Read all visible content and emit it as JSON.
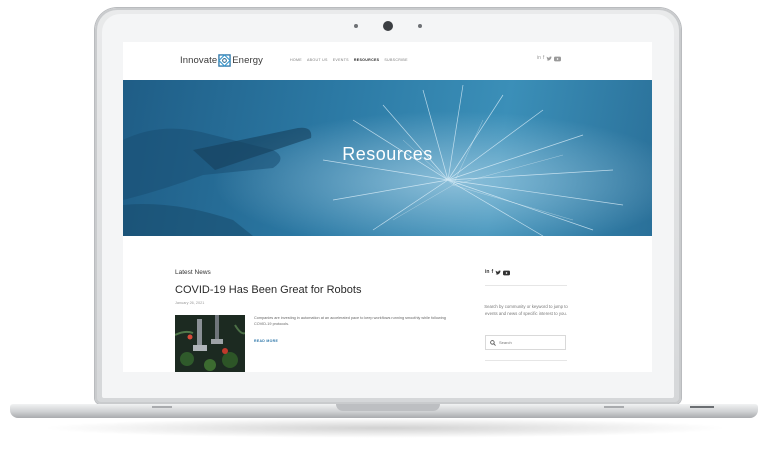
{
  "site": {
    "logo": {
      "left_text": "Innovate",
      "right_text": "Energy"
    },
    "nav": [
      {
        "label": "HOME",
        "active": false
      },
      {
        "label": "ABOUT US",
        "active": false
      },
      {
        "label": "EVENTS",
        "active": false
      },
      {
        "label": "RESOURCES",
        "active": true
      },
      {
        "label": "SUBSCRIBE",
        "active": false
      }
    ],
    "social_icons": [
      "linkedin-icon",
      "facebook-icon",
      "twitter-icon",
      "youtube-icon"
    ]
  },
  "hero": {
    "title": "Resources"
  },
  "main": {
    "section_label": "Latest News",
    "post": {
      "title": "COVID-19 Has Been Great for Robots",
      "date": "January 26, 2021",
      "excerpt": "Companies are investing in automation at an accelerated pace to keep workflows running smoothly while following COVID-19 protocols.",
      "read_more": "READ MORE"
    }
  },
  "sidebar": {
    "social_icons": [
      "linkedin-icon",
      "facebook-icon",
      "twitter-icon",
      "youtube-icon"
    ],
    "description": "Search by community or keyword to jump to events and news of specific interest to you.",
    "search": {
      "placeholder": "Search",
      "value": ""
    }
  },
  "colors": {
    "accent": "#2b75a8",
    "hero_blue": "#2c7aa5",
    "text_dark": "#2a2a2a"
  }
}
